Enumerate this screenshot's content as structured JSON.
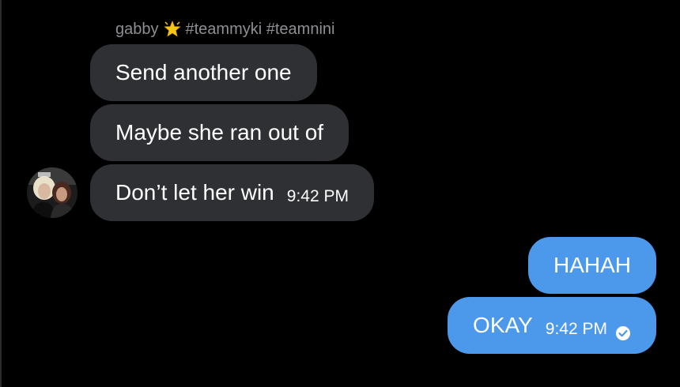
{
  "conversation": {
    "sender": {
      "name": "gabby",
      "emoji_icon": "glowing-star-icon",
      "tags": "#teammyki #teamnini",
      "avatar_icon": "avatar-photo"
    },
    "incoming": [
      {
        "text": "Send another one"
      },
      {
        "text": "Maybe she ran out of"
      },
      {
        "text": "Don’t let her win",
        "time": "9:42 PM"
      }
    ],
    "outgoing": [
      {
        "text": "HAHAH"
      },
      {
        "text": "OKAY",
        "time": "9:42 PM",
        "status_icon": "read-check-icon"
      }
    ]
  },
  "colors": {
    "background": "#000000",
    "incoming_bubble": "#2f3033",
    "outgoing_bubble": "#4c98ea",
    "sender_text": "#8e8e93"
  }
}
